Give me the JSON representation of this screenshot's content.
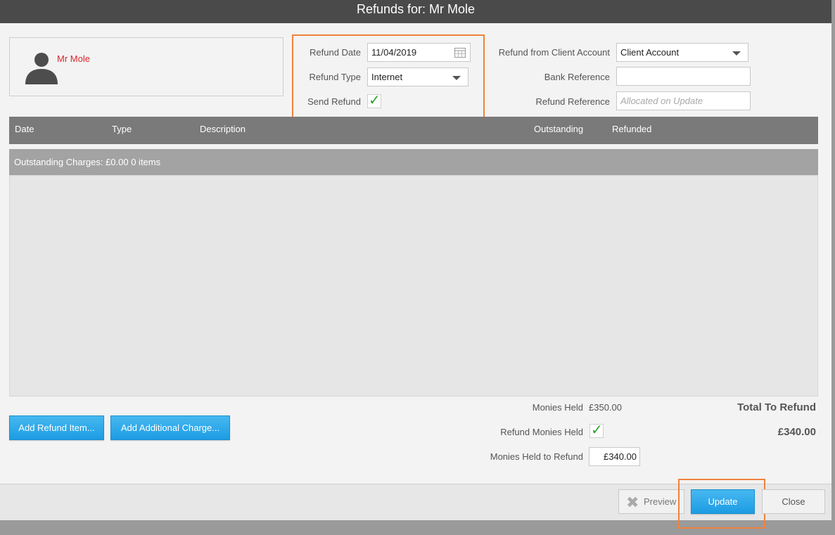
{
  "window": {
    "title": "Refunds for: Mr Mole"
  },
  "client": {
    "name": "Mr Mole",
    "avatar_icon": "user-silhouette-icon"
  },
  "refund": {
    "date_label": "Refund Date",
    "date_value": "11/04/2019",
    "type_label": "Refund Type",
    "type_value": "Internet",
    "send_label": "Send Refund",
    "send_checked": true
  },
  "account": {
    "from_label": "Refund from Client Account",
    "from_value": "Client Account",
    "bank_ref_label": "Bank Reference",
    "bank_ref_value": "",
    "refund_ref_label": "Refund Reference",
    "refund_ref_placeholder": "Allocated on Update"
  },
  "table": {
    "columns": [
      "Date",
      "Type",
      "Description",
      "Outstanding",
      "Refunded"
    ],
    "group_label": "Outstanding Charges: £0.00 0 items",
    "rows": []
  },
  "buttons": {
    "add_refund_item": "Add Refund Item...",
    "add_additional_charge": "Add Additional Charge...",
    "preview": "Preview",
    "update": "Update",
    "close": "Close"
  },
  "summary": {
    "monies_held_label": "Monies Held",
    "monies_held_value": "£350.00",
    "refund_monies_held_label": "Refund Monies Held",
    "refund_monies_held_checked": true,
    "monies_to_refund_label": "Monies Held to Refund",
    "monies_to_refund_value": "£340.00",
    "total_label": "Total To Refund",
    "total_value": "£340.00"
  },
  "colors": {
    "accent_blue": "#1c9ce4",
    "highlight_orange": "#f0823c",
    "client_red": "#d9262e",
    "check_green": "#2aa32a"
  }
}
